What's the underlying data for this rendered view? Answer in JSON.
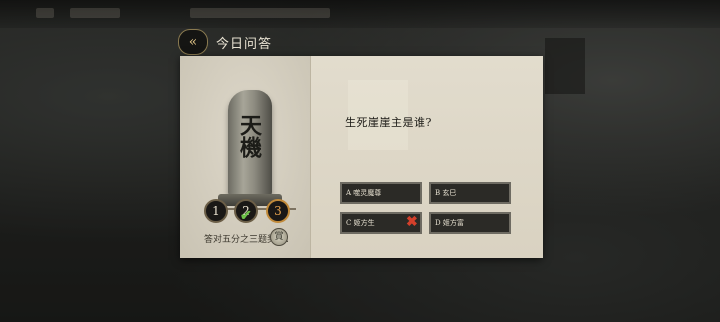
{
  "header": {
    "back_icon": "back-arrows-icon",
    "title": "今日问答"
  },
  "tablet": {
    "inscription": "天機"
  },
  "progress": {
    "steps": [
      {
        "label": "1",
        "state": "unanswered"
      },
      {
        "label": "2",
        "state": "correct"
      },
      {
        "label": "3",
        "state": "current"
      }
    ]
  },
  "reward": {
    "label": "答对五分之三题奖励：",
    "icon": "reward-token-icon",
    "icon_text": "賞"
  },
  "question": {
    "text": "生死崖崖主是谁?"
  },
  "options": [
    {
      "label": "A  噬灵魔尊",
      "state": "normal"
    },
    {
      "label": "B  玄巳",
      "state": "normal"
    },
    {
      "label": "C  姬方生",
      "state": "wrong"
    },
    {
      "label": "D  姬方富",
      "state": "normal"
    }
  ],
  "colors": {
    "accent_gold": "#c18a3a",
    "correct_green": "#6ec24a",
    "wrong_red": "#d4402b"
  }
}
